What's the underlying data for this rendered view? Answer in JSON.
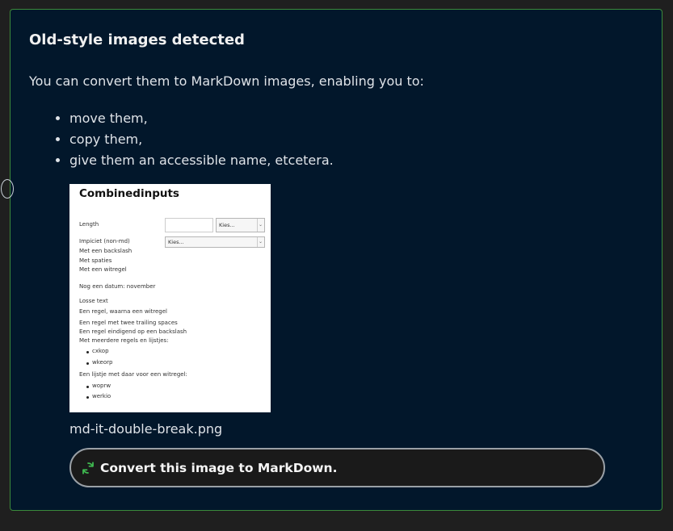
{
  "panel": {
    "title": "Old-style images detected",
    "intro": "You can convert them to MarkDown images, enabling you to:",
    "benefits": [
      "move them,",
      "copy them,",
      "give them an accessible name, etcetera."
    ]
  },
  "thumbnail": {
    "title": "Combinedinputs",
    "length_label": "Length",
    "select1": "Kies...",
    "impliciet_label": "Impiciet (non-md)",
    "select2": "Kies...",
    "lines_a": [
      "Met een backslash",
      "Met spaties",
      "Met een witregel"
    ],
    "datum_line": "Nog een datum: november",
    "lines_b": [
      "Losse text",
      "Een regel, waarna een witregel",
      "Een regel met twee trailing spaces",
      "Een regel eindigend op een backslash",
      "Met meerdere regels en lijstjes:"
    ],
    "list1": [
      "cxkop",
      "wkeorp"
    ],
    "list_intro": "Een lijstje met daar voor een witregel:",
    "list2": [
      "woprw",
      "werkio"
    ]
  },
  "filename": "md-it-double-break.png",
  "convert_button": {
    "label": "Convert this image to MarkDown.",
    "icon": "refresh-icon",
    "icon_color": "#3fb950"
  },
  "colors": {
    "panel_bg": "#02172b",
    "panel_border": "#3b8a3b",
    "page_bg": "#1f1f1f"
  }
}
